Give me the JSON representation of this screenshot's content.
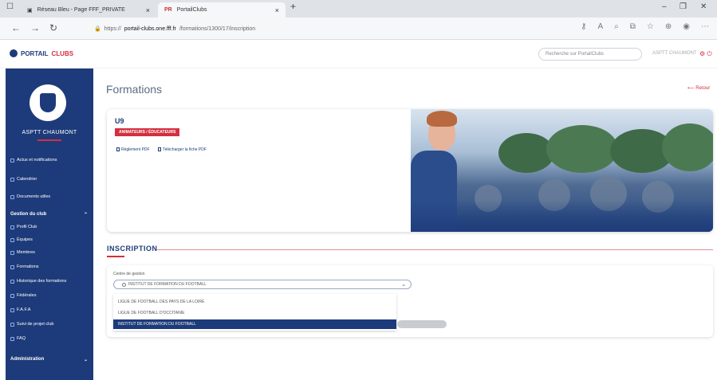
{
  "browser": {
    "tabs": [
      {
        "label": "Réseau Bleu - Page FFF_PRIVATE",
        "active": false
      },
      {
        "label": "PortailClubs",
        "active": true
      }
    ],
    "new_tab": "+",
    "window_controls": [
      "–",
      "❐",
      "✕"
    ],
    "url_prefix": "https://",
    "url_domain": "portail-clubs.one.fff.fr",
    "url_path": "/formations/1300/17/inscription",
    "toolbar_icons": [
      "key-icon",
      "read-aloud-icon",
      "zoom-icon",
      "extension-icon",
      "favorite-icon",
      "collections-icon",
      "profile-icon",
      "more-icon"
    ]
  },
  "header": {
    "logo_part1": "PORTAIL",
    "logo_part2": "CLUBS",
    "search_placeholder": "Recherche sur PortailClubs",
    "user_name": "ASPTT CHAUMONT"
  },
  "sidebar": {
    "club_name": "ASPTT CHAUMONT",
    "items": [
      {
        "label": "Actus et notifications",
        "icon": "bell-icon"
      },
      {
        "label": "Calendrier",
        "icon": "calendar-icon"
      },
      {
        "label": "Documents utiles",
        "icon": "document-icon"
      },
      {
        "label": "Gestion du club",
        "icon": "",
        "head": true
      },
      {
        "label": "Profil Club",
        "icon": "club-icon"
      },
      {
        "label": "Équipes",
        "icon": "team-icon"
      },
      {
        "label": "Membres",
        "icon": "members-icon"
      },
      {
        "label": "Formations",
        "icon": "formation-icon"
      },
      {
        "label": "Historique des formations",
        "icon": "history-icon"
      },
      {
        "label": "Fédérales",
        "icon": "star-icon"
      },
      {
        "label": "F.A.F.A",
        "icon": "bank-icon"
      },
      {
        "label": "Suivi de projet club",
        "icon": "project-icon"
      },
      {
        "label": "FAQ",
        "icon": "faq-icon"
      },
      {
        "label": "Administration",
        "icon": "",
        "head": true
      }
    ]
  },
  "main": {
    "title": "Formations",
    "back_label": "Retour",
    "card": {
      "code": "U9",
      "tag": "ANIMATEURS / ÉDUCATEURS",
      "links": [
        "Règlement PDF",
        "Télécharger la fiche PDF"
      ]
    },
    "section_title": "INSCRIPTION",
    "field_label": "Centre de gestion",
    "selected_value": "INSTITUT DE FORMATION DU FOOTBALL",
    "options": [
      {
        "label": "LIGUE DE FOOTBALL DES PAYS DE LA LOIRE",
        "selected": false
      },
      {
        "label": "LIGUE DE FOOTBALL D'OCCITANIE",
        "selected": false
      },
      {
        "label": "INSTITUT DE FORMATION DU FOOTBALL",
        "selected": true
      }
    ]
  },
  "colors": {
    "brand_blue": "#1d3b7a",
    "brand_red": "#d32f3f"
  }
}
